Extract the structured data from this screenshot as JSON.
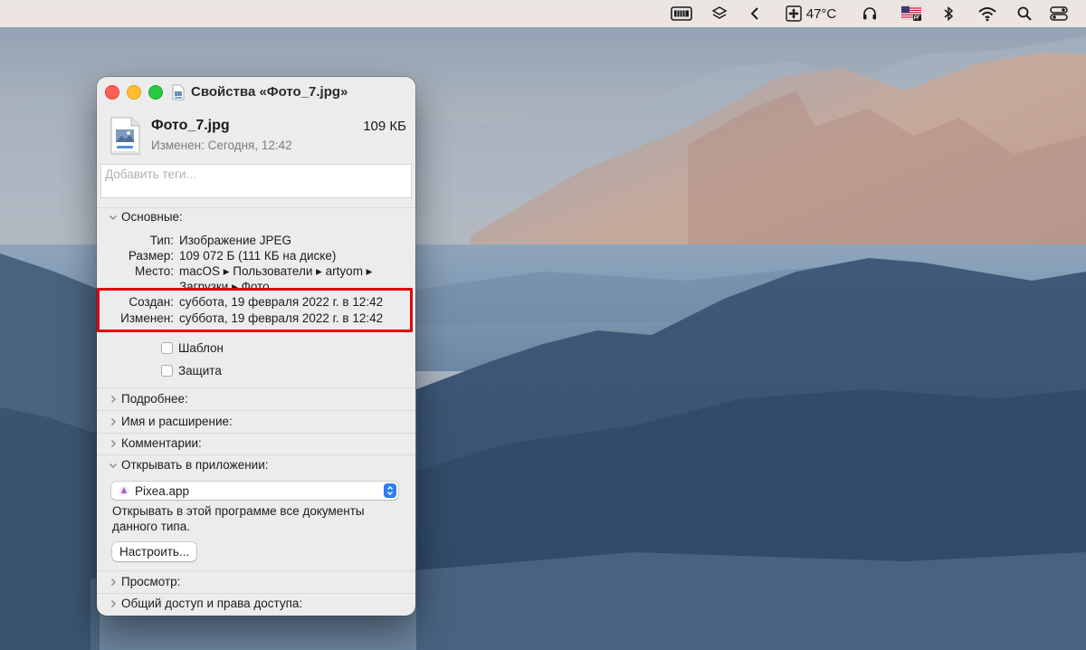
{
  "menubar": {
    "temperature": "47°C"
  },
  "window": {
    "title": "Свойства «Фото_7.jpg»",
    "file": {
      "name": "Фото_7.jpg",
      "size": "109 КБ",
      "modified": "Изменен: Сегодня, 12:42"
    },
    "tags_placeholder": "Добавить теги...",
    "general": {
      "header": "Основные:",
      "type_label": "Тип:",
      "type_value": "Изображение JPEG",
      "size_label": "Размер:",
      "size_value": "109 072 Б (111 КБ на диске)",
      "where_label": "Место:",
      "where_line1": "macOS ▸ Пользователи ▸ artyom ▸",
      "where_line2": "Загрузки ▸ Фото",
      "created_label": "Создан:",
      "created_value": "суббота, 19 февраля 2022 г. в 12:42",
      "modified_label": "Изменен:",
      "modified_value": "суббота, 19 февраля 2022 г. в 12:42",
      "stationery_label": "Шаблон",
      "locked_label": "Защита"
    },
    "sections": {
      "more_info": "Подробнее:",
      "name_ext": "Имя и расширение:",
      "comments": "Комментарии:",
      "open_with": "Открывать в приложении:",
      "preview": "Просмотр:",
      "sharing": "Общий доступ и права доступа:"
    },
    "open_with": {
      "app": "Pixea.app",
      "description": "Открывать в этой программе все документы данного типа.",
      "configure_button": "Настроить..."
    }
  },
  "colors": {
    "highlight": "#e3000f",
    "close": "#ff5f57",
    "minimize": "#febc2e",
    "zoom": "#28c840",
    "select_accent": "#2f7df6"
  }
}
